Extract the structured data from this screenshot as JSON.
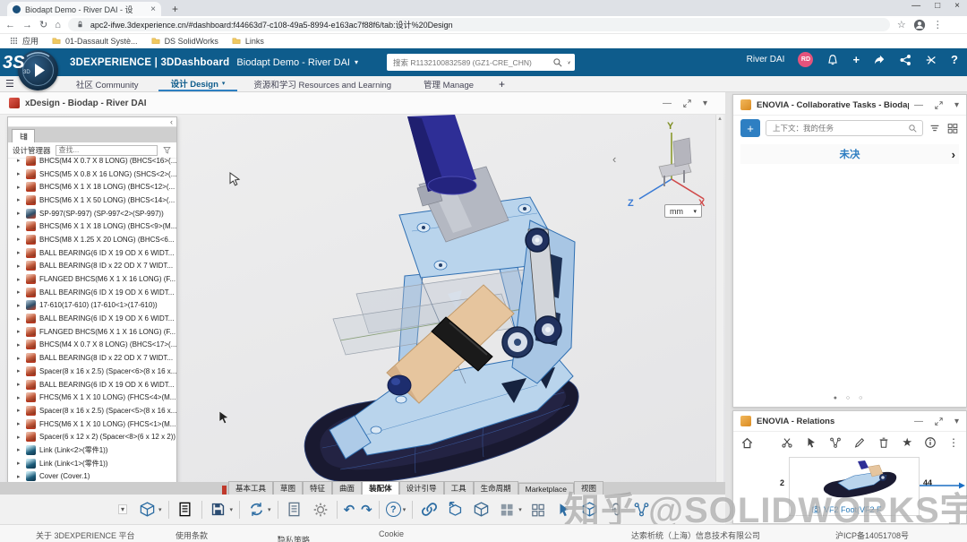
{
  "icons": {
    "minimize": "—",
    "restore": "□",
    "close": "×",
    "back": "←",
    "forward": "→",
    "reload": "↻",
    "home": "⌂",
    "star": "☆",
    "star_solid": "★",
    "kebab": "⋮",
    "plus": "+",
    "help": "?",
    "caret_down": "▾",
    "caret_up": "▴",
    "chevron_left": "‹",
    "chevron_right": "›",
    "tree_expand": "▸",
    "undo": "↶",
    "redo": "↷",
    "dot_on": "●",
    "dot_off": "○ ○"
  },
  "browser": {
    "tab_title": "Biodapt Demo - River DAI - 设",
    "url": "apc2-ifwe.3dexperience.cn/#dashboard:f44663d7-c108-49a5-8994-e163ac7f88f6/tab:设计%20Design",
    "bookmarks": {
      "apps": "应用",
      "b1": "01-Dassault Systè...",
      "b2": "DS SolidWorks",
      "b3": "Links"
    }
  },
  "header": {
    "brand": "3DEXPERIENCE | 3DDashboard",
    "dashboard": "Biodapt Demo - River DAI",
    "search_placeholder": "搜索 R1132100832589 (GZ1-CRE_CHN)",
    "user_name": "River DAI",
    "user_initials": "RD"
  },
  "nav_tabs": [
    {
      "label": "社区 Community",
      "state": ""
    },
    {
      "label": "设计 Design",
      "state": "active",
      "caret": "▾"
    },
    {
      "label": "资源和学习 Resources and Learning",
      "state": ""
    },
    {
      "label": "管理 Manage",
      "state": ""
    }
  ],
  "xdesign": {
    "title": "xDesign - Biodap - River DAI",
    "tree": {
      "manager_label": "设计管理器",
      "search_placeholder": "查找...",
      "items": [
        {
          "label": "BHCS(M4 X 0.7 X 8 LONG) (BHCS<16>(...",
          "type": "red"
        },
        {
          "label": "SHCS(M5 X 0.8 X 16 LONG) (SHCS<2>(...",
          "type": "red"
        },
        {
          "label": "BHCS(M6 X 1 X 18 LONG) (BHCS<12>(...",
          "type": "red"
        },
        {
          "label": "BHCS(M6 X 1 X 50 LONG) (BHCS<14>(...",
          "type": "red"
        },
        {
          "label": "SP-997(SP-997) (SP-997<2>(SP-997))",
          "type": "blue"
        },
        {
          "label": "BHCS(M6 X 1 X 18 LONG) (BHCS<9>(M...",
          "type": "red"
        },
        {
          "label": "BHCS(M8 X 1.25 X 20 LONG) (BHCS<6...",
          "type": "red"
        },
        {
          "label": "BALL BEARING(6 ID X 19 OD X 6 WIDT...",
          "type": "red"
        },
        {
          "label": "BALL BEARING(8 ID x 22 OD X 7 WIDT...",
          "type": "red"
        },
        {
          "label": "FLANGED BHCS(M6 X 1 X 16 LONG) (F...",
          "type": "red"
        },
        {
          "label": "BALL BEARING(6 ID X 19 OD X 6 WIDT...",
          "type": "red"
        },
        {
          "label": "17-610(17-610) (17-610<1>(17-610))",
          "type": "blue"
        },
        {
          "label": "BALL BEARING(6 ID X 19 OD X 6 WIDT...",
          "type": "red"
        },
        {
          "label": "FLANGED BHCS(M6 X 1 X 16 LONG) (F...",
          "type": "red"
        },
        {
          "label": "BHCS(M4 X 0.7 X 8 LONG) (BHCS<17>(...",
          "type": "red"
        },
        {
          "label": "BALL BEARING(8 ID x 22 OD X 7 WIDT...",
          "type": "red"
        },
        {
          "label": "Spacer(8 x 16 x 2.5) (Spacer<6>(8 x 16 x...",
          "type": "red"
        },
        {
          "label": "BALL BEARING(6 ID X 19 OD X 6 WIDT...",
          "type": "red"
        },
        {
          "label": "FHCS(M6 X 1 X 10 LONG) (FHCS<4>(M...",
          "type": "red"
        },
        {
          "label": "Spacer(8 x 16 x 2.5) (Spacer<5>(8 x 16 x...",
          "type": "red"
        },
        {
          "label": "FHCS(M6 X 1 X 10 LONG) (FHCS<1>(M...",
          "type": "red"
        },
        {
          "label": "Spacer(6 x 12 x 2) (Spacer<8>(6 x 12 x 2))",
          "type": "red"
        },
        {
          "label": "Link (Link<2>(零件1))",
          "type": "cube"
        },
        {
          "label": "Link (Link<1>(零件1))",
          "type": "cube"
        },
        {
          "label": "Cover (Cover.1)",
          "type": "cube"
        }
      ]
    },
    "viewport": {
      "units": "mm",
      "axis_x": "X",
      "axis_y": "Y",
      "axis_z": "Z"
    },
    "ribbon_tabs": [
      {
        "label": "基本工具",
        "state": ""
      },
      {
        "label": "草图",
        "state": ""
      },
      {
        "label": "特征",
        "state": ""
      },
      {
        "label": "曲面",
        "state": ""
      },
      {
        "label": "装配体",
        "state": "active"
      },
      {
        "label": "设计引导",
        "state": ""
      },
      {
        "label": "工具",
        "state": ""
      },
      {
        "label": "生命周期",
        "state": ""
      },
      {
        "label": "Marketplace",
        "state": ""
      },
      {
        "label": "视图",
        "state": ""
      }
    ]
  },
  "tasks_panel": {
    "title": "ENOVIA - Collaborative Tasks - Biodap - Riv...",
    "search_placeholder": "上下文：我的任务",
    "column_label": "未决"
  },
  "relations_panel": {
    "title": "ENOVIA - Relations",
    "count_left": "2",
    "count_right": "44",
    "card_caption": "VF2 Foot(VF2 F"
  },
  "statusbar": {
    "about": "关于 3DEXPERIENCE 平台",
    "terms": "使用条款",
    "privacy": "隐私策略",
    "cookie": "Cookie",
    "company": "达索析统（上海）信息技术有限公司",
    "icp": "沪ICP备14051708号"
  },
  "watermark": "知乎 @SOLIDWORKS宇喜科技"
}
